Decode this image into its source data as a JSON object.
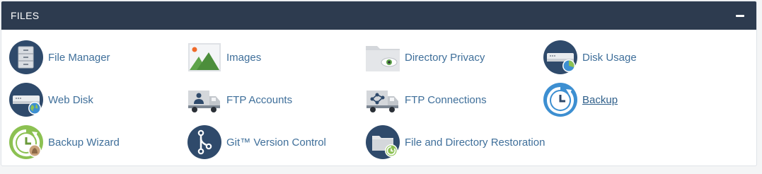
{
  "panel": {
    "title": "FILES",
    "collapse_icon": "minus-icon"
  },
  "colors": {
    "header_bg": "#2d3b4f",
    "link": "#3f6f9a",
    "icon_navy": "#2f4a6b",
    "icon_blue": "#3d8fd1",
    "icon_green": "#8cc152"
  },
  "items": [
    {
      "label": "File Manager",
      "icon": "file-manager-icon"
    },
    {
      "label": "Images",
      "icon": "images-icon"
    },
    {
      "label": "Directory Privacy",
      "icon": "directory-privacy-icon"
    },
    {
      "label": "Disk Usage",
      "icon": "disk-usage-icon"
    },
    {
      "label": "Web Disk",
      "icon": "web-disk-icon"
    },
    {
      "label": "FTP Accounts",
      "icon": "ftp-accounts-icon"
    },
    {
      "label": "FTP Connections",
      "icon": "ftp-connections-icon"
    },
    {
      "label": "Backup",
      "icon": "backup-icon"
    },
    {
      "label": "Backup Wizard",
      "icon": "backup-wizard-icon"
    },
    {
      "label": "Git™ Version Control",
      "icon": "git-version-control-icon"
    },
    {
      "label": "File and Directory Restoration",
      "icon": "file-directory-restoration-icon"
    }
  ]
}
